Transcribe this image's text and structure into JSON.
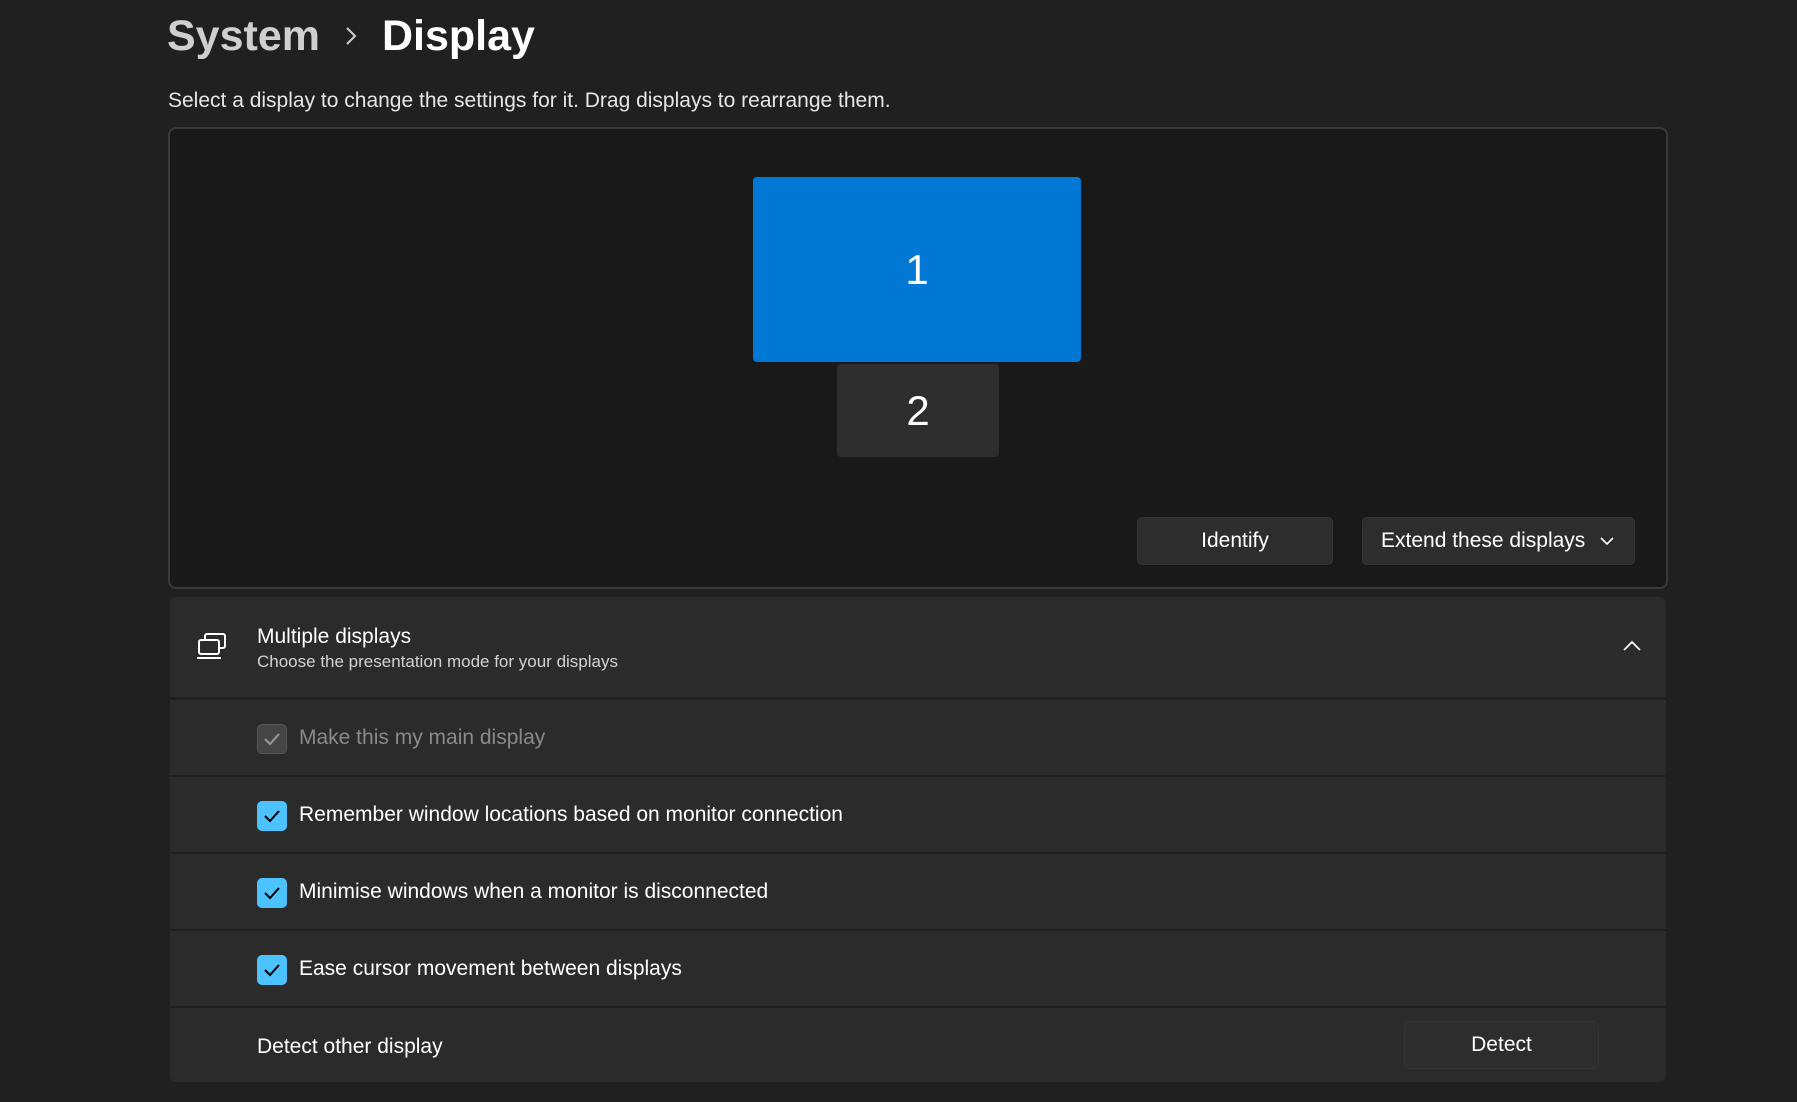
{
  "breadcrumb": {
    "parent": "System",
    "current": "Display"
  },
  "description": "Select a display to change the settings for it. Drag displays to rearrange them.",
  "arrangement": {
    "monitors": [
      {
        "label": "1",
        "selected": true,
        "color": "#0078d4"
      },
      {
        "label": "2",
        "selected": false,
        "color": "#2e2e2e"
      }
    ],
    "identify_label": "Identify",
    "mode_dropdown": {
      "selected": "Extend these displays"
    }
  },
  "multiple_displays": {
    "title": "Multiple displays",
    "subtitle": "Choose the presentation mode for your displays",
    "expanded": true,
    "options": [
      {
        "label": "Make this my main display",
        "checked": true,
        "disabled": true
      },
      {
        "label": "Remember window locations based on monitor connection",
        "checked": true,
        "disabled": false
      },
      {
        "label": "Minimise windows when a monitor is disconnected",
        "checked": true,
        "disabled": false
      },
      {
        "label": "Ease cursor movement between displays",
        "checked": true,
        "disabled": false
      }
    ],
    "detect": {
      "label": "Detect other display",
      "button_label": "Detect"
    }
  },
  "colors": {
    "background": "#202020",
    "accent": "#0078d4",
    "checkbox_accent": "#4cc2ff"
  }
}
